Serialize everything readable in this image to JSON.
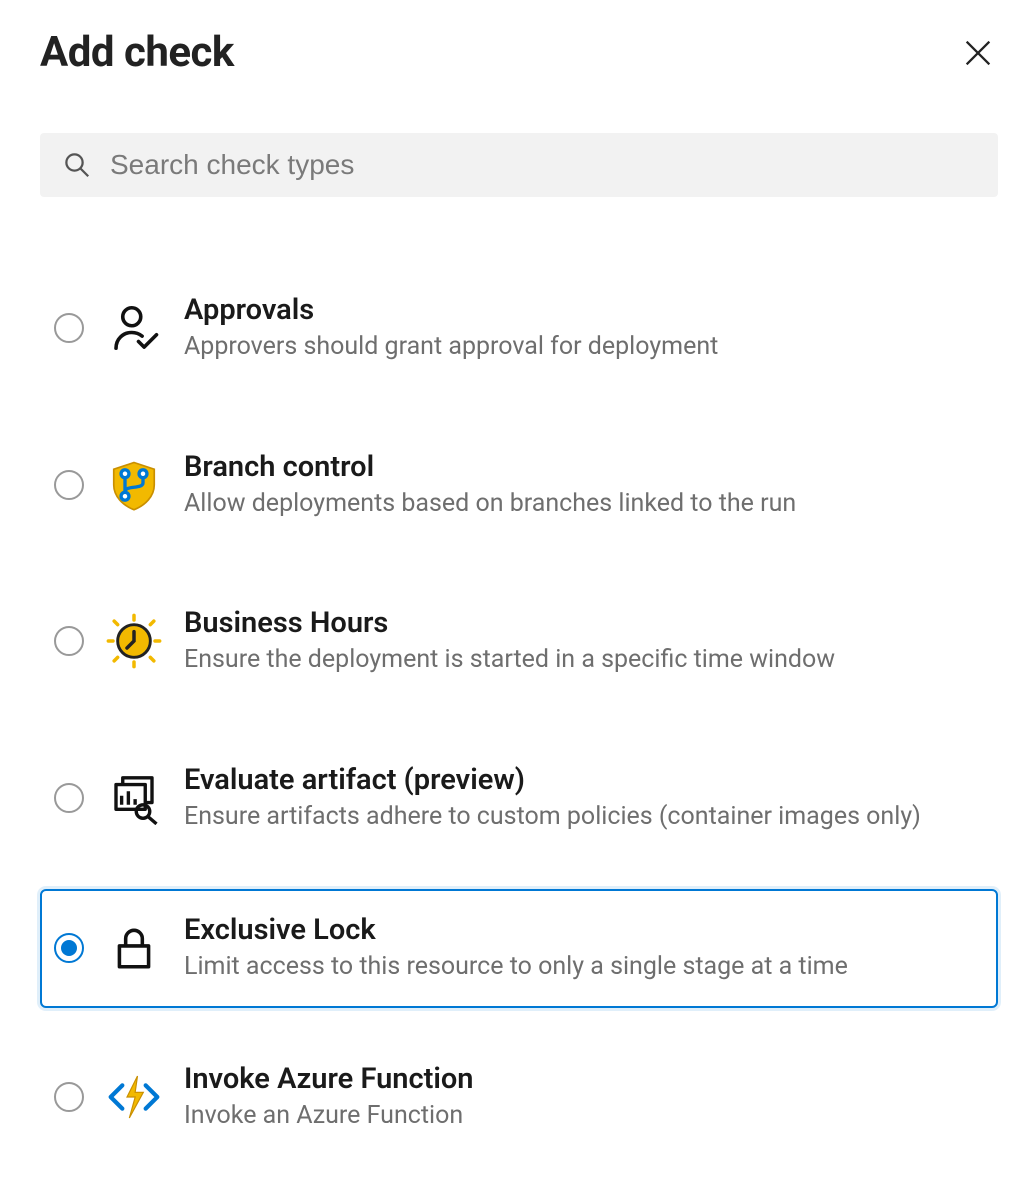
{
  "header": {
    "title": "Add check"
  },
  "search": {
    "placeholder": "Search check types"
  },
  "checks": [
    {
      "title": "Approvals",
      "desc": "Approvers should grant approval for deployment",
      "selected": false,
      "icon_name": "person-check-icon"
    },
    {
      "title": "Branch control",
      "desc": "Allow deployments based on branches linked to the run",
      "selected": false,
      "icon_name": "branch-shield-icon"
    },
    {
      "title": "Business Hours",
      "desc": "Ensure the deployment is started in a specific time window",
      "selected": false,
      "icon_name": "clock-sun-icon"
    },
    {
      "title": "Evaluate artifact (preview)",
      "desc": "Ensure artifacts adhere to custom policies (container images only)",
      "selected": false,
      "icon_name": "artifact-scan-icon"
    },
    {
      "title": "Exclusive Lock",
      "desc": "Limit access to this resource to only a single stage at a time",
      "selected": true,
      "icon_name": "lock-icon"
    },
    {
      "title": "Invoke Azure Function",
      "desc": "Invoke an Azure Function",
      "selected": false,
      "icon_name": "azure-function-icon"
    }
  ]
}
